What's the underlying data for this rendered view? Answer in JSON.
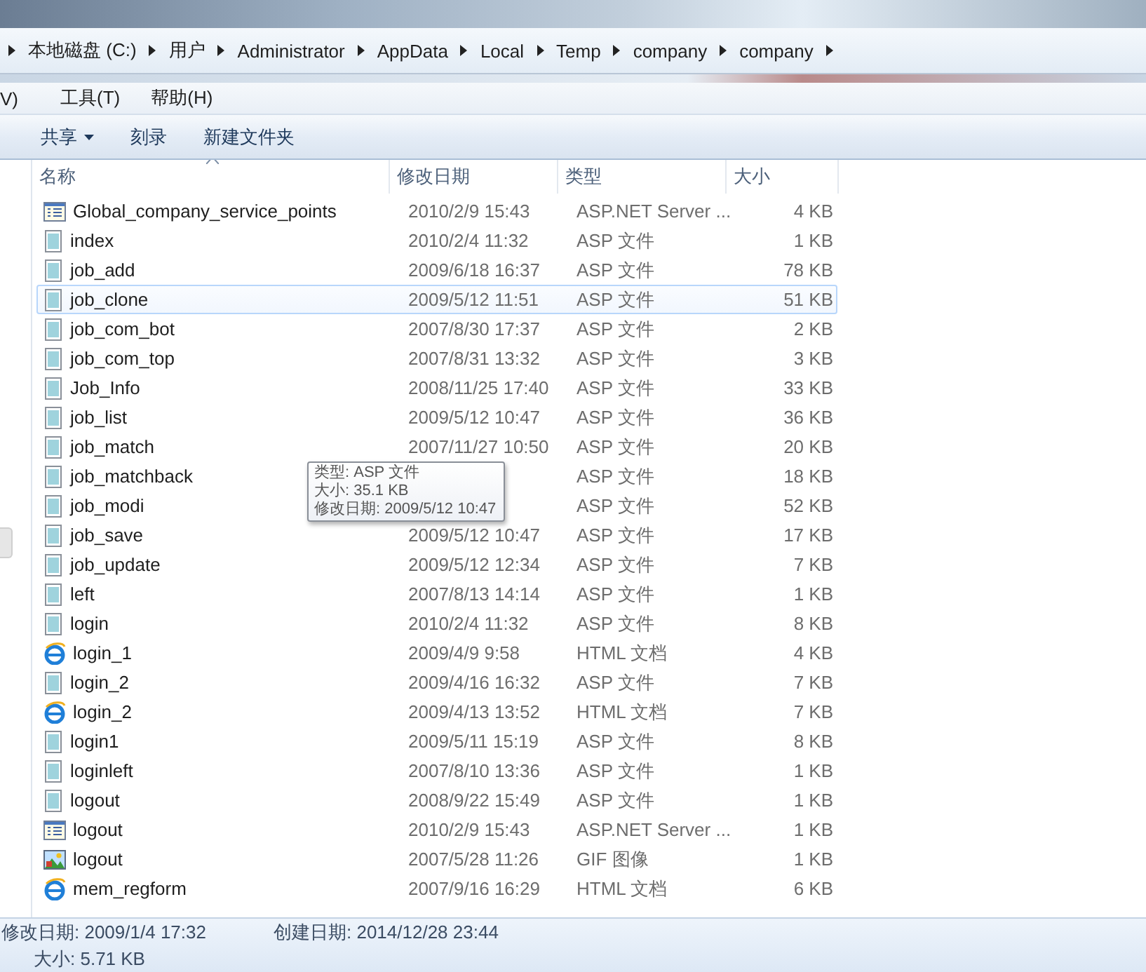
{
  "address_bar": {
    "crumbs": [
      "本地磁盘 (C:)",
      "用户",
      "Administrator",
      "AppData",
      "Local",
      "Temp",
      "company",
      "company"
    ]
  },
  "menu_bar": [
    "V)",
    "工具(T)",
    "帮助(H)"
  ],
  "command_bar": [
    {
      "label": "共享",
      "dropdown": true
    },
    {
      "label": "刻录",
      "dropdown": false
    },
    {
      "label": "新建文件夹",
      "dropdown": false
    }
  ],
  "file_list": {
    "columns": [
      "名称",
      "修改日期",
      "类型",
      "大小"
    ],
    "rows": [
      {
        "kind": "aspx",
        "name": "Global_company_service_points",
        "date": "2010/2/9 15:43",
        "type": "ASP.NET Server ...",
        "size": "4 KB",
        "highlighted": false
      },
      {
        "kind": "asp",
        "name": "index",
        "date": "2010/2/4 11:32",
        "type": "ASP 文件",
        "size": "1 KB",
        "highlighted": false
      },
      {
        "kind": "asp",
        "name": "job_add",
        "date": "2009/6/18 16:37",
        "type": "ASP 文件",
        "size": "78 KB",
        "highlighted": false
      },
      {
        "kind": "asp",
        "name": "job_clone",
        "date": "2009/5/12 11:51",
        "type": "ASP 文件",
        "size": "51 KB",
        "highlighted": true
      },
      {
        "kind": "asp",
        "name": "job_com_bot",
        "date": "2007/8/30 17:37",
        "type": "ASP 文件",
        "size": "2 KB",
        "highlighted": false
      },
      {
        "kind": "asp",
        "name": "job_com_top",
        "date": "2007/8/31 13:32",
        "type": "ASP 文件",
        "size": "3 KB",
        "highlighted": false
      },
      {
        "kind": "asp",
        "name": "Job_Info",
        "date": "2008/11/25 17:40",
        "type": "ASP 文件",
        "size": "33 KB",
        "highlighted": false
      },
      {
        "kind": "asp",
        "name": "job_list",
        "date": "2009/5/12 10:47",
        "type": "ASP 文件",
        "size": "36 KB",
        "highlighted": false
      },
      {
        "kind": "asp",
        "name": "job_match",
        "date": "2007/11/27 10:50",
        "type": "ASP 文件",
        "size": "20 KB",
        "highlighted": false
      },
      {
        "kind": "asp",
        "name": "job_matchback",
        "type": "ASP 文件",
        "size": "18 KB",
        "highlighted": false
      },
      {
        "kind": "asp",
        "name": "job_modi",
        "type": "ASP 文件",
        "size": "52 KB",
        "highlighted": false
      },
      {
        "kind": "asp",
        "name": "job_save",
        "date": "2009/5/12 10:47",
        "type": "ASP 文件",
        "size": "17 KB",
        "highlighted": false
      },
      {
        "kind": "asp",
        "name": "job_update",
        "date": "2009/5/12 12:34",
        "type": "ASP 文件",
        "size": "7 KB",
        "highlighted": false
      },
      {
        "kind": "asp",
        "name": "left",
        "date": "2007/8/13 14:14",
        "type": "ASP 文件",
        "size": "1 KB",
        "highlighted": false
      },
      {
        "kind": "asp",
        "name": "login",
        "date": "2010/2/4 11:32",
        "type": "ASP 文件",
        "size": "8 KB",
        "highlighted": false
      },
      {
        "kind": "html",
        "name": "login_1",
        "date": "2009/4/9 9:58",
        "type": "HTML 文档",
        "size": "4 KB",
        "highlighted": false
      },
      {
        "kind": "asp",
        "name": "login_2",
        "date": "2009/4/16 16:32",
        "type": "ASP 文件",
        "size": "7 KB",
        "highlighted": false
      },
      {
        "kind": "html",
        "name": "login_2",
        "date": "2009/4/13 13:52",
        "type": "HTML 文档",
        "size": "7 KB",
        "highlighted": false
      },
      {
        "kind": "asp",
        "name": "login1",
        "date": "2009/5/11 15:19",
        "type": "ASP 文件",
        "size": "8 KB",
        "highlighted": false
      },
      {
        "kind": "asp",
        "name": "loginleft",
        "date": "2007/8/10 13:36",
        "type": "ASP 文件",
        "size": "1 KB",
        "highlighted": false
      },
      {
        "kind": "asp",
        "name": "logout",
        "date": "2008/9/22 15:49",
        "type": "ASP 文件",
        "size": "1 KB",
        "highlighted": false
      },
      {
        "kind": "aspx",
        "name": "logout",
        "date": "2010/2/9 15:43",
        "type": "ASP.NET Server ...",
        "size": "1 KB",
        "highlighted": false
      },
      {
        "kind": "gif",
        "name": "logout",
        "date": "2007/5/28 11:26",
        "type": "GIF 图像",
        "size": "1 KB",
        "highlighted": false
      },
      {
        "kind": "html",
        "name": "mem_regform",
        "date": "2007/9/16 16:29",
        "type": "HTML 文档",
        "size": "6 KB",
        "highlighted": false
      }
    ]
  },
  "tooltip": [
    "类型: ASP 文件",
    "大小: 35.1 KB",
    "修改日期: 2009/5/12 10:47"
  ],
  "details_pane": {
    "modified": "修改日期: 2009/1/4 17:32",
    "created": "创建日期: 2014/12/28 23:44",
    "size": "大小: 5.71 KB"
  }
}
